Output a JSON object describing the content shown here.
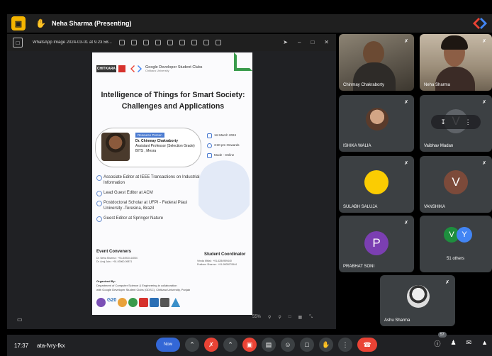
{
  "topbar": {
    "logo": "▣",
    "title": "Neha Sharma (Presenting)"
  },
  "present_head": {
    "file_name": "WhatsApp Image 2024-03-01 at 9.23.58..."
  },
  "poster": {
    "chitkara": "CHITKARA",
    "gdsc_name": "Google Developer Student Clubs",
    "gdsc_sub": "Chitkara University",
    "title": "Intelligence of Things for Smart Society: Challenges and Applications",
    "resource_label": "Resource Person",
    "rp_name": "Dr. Chinmay Chakraborty",
    "rp_role": "Assistant Professor (Selection Grade)",
    "rp_org": "BITS , Mesra",
    "date": "1st March 2024",
    "time": "3:30 pm Onwards",
    "mode": "Mode - Online",
    "bullets": [
      "Associate Editor at IEEE Transactions on Industrial Information",
      "Lead Guest Editor at ACM",
      "Postdoctoral Scholar at UFPI - Federal Piaui University -Teresina, Brazil",
      "Guest Editor at Springer Nature"
    ],
    "event_conveners": "Event Conveners",
    "conveners_line1": "Dr. Neha Sharma : +91-84910-44054",
    "conveners_line2": "Dr. Anuj Jain : +91-93960-09871",
    "student_coordinator": "Student Coordinator",
    "coord_line1": "Vrinda Mittal : +91-6284959440",
    "coord_line2": "Prathem Sharma : +91-9905079544",
    "organized_by": "Organized By:",
    "org_line1": "Department of Computer Science & Engineering in collaboration",
    "org_line2": "with Google Developer Student Clubs (GDSC), Chitkara University, Punjab",
    "g20": "G20"
  },
  "zoom": {
    "level": "55%"
  },
  "participants": [
    {
      "name": "Chinmay Chakraborty"
    },
    {
      "name": "Neha Sharma"
    },
    {
      "name": "ISHIKA WALIA"
    },
    {
      "name": "Vaibhav Madan",
      "initial": "V"
    },
    {
      "name": "SULABH SALUJA"
    },
    {
      "name": "VANSHIKA",
      "initial": "V"
    },
    {
      "name": "PRABHAT SONI",
      "initial": "P"
    },
    {
      "name": "51 others",
      "chip1": "V",
      "chip2": "Y"
    },
    {
      "name": "Ashu Sharma"
    }
  ],
  "bottombar": {
    "time": "17:37",
    "code": "ata-fvry-fkx",
    "participant_count": "57",
    "present_label": "Now"
  },
  "colors": {
    "accent": "#3367d6",
    "end_call": "#ea4335",
    "tile_bg": "#3c4043",
    "vanshika_avatar": "#7c4a3a",
    "prabhat_avatar": "#7b3fb2",
    "chip_v": "#1e8e3e",
    "chip_y": "#4285f4",
    "sulabh_avatar": "#fbcc02"
  }
}
